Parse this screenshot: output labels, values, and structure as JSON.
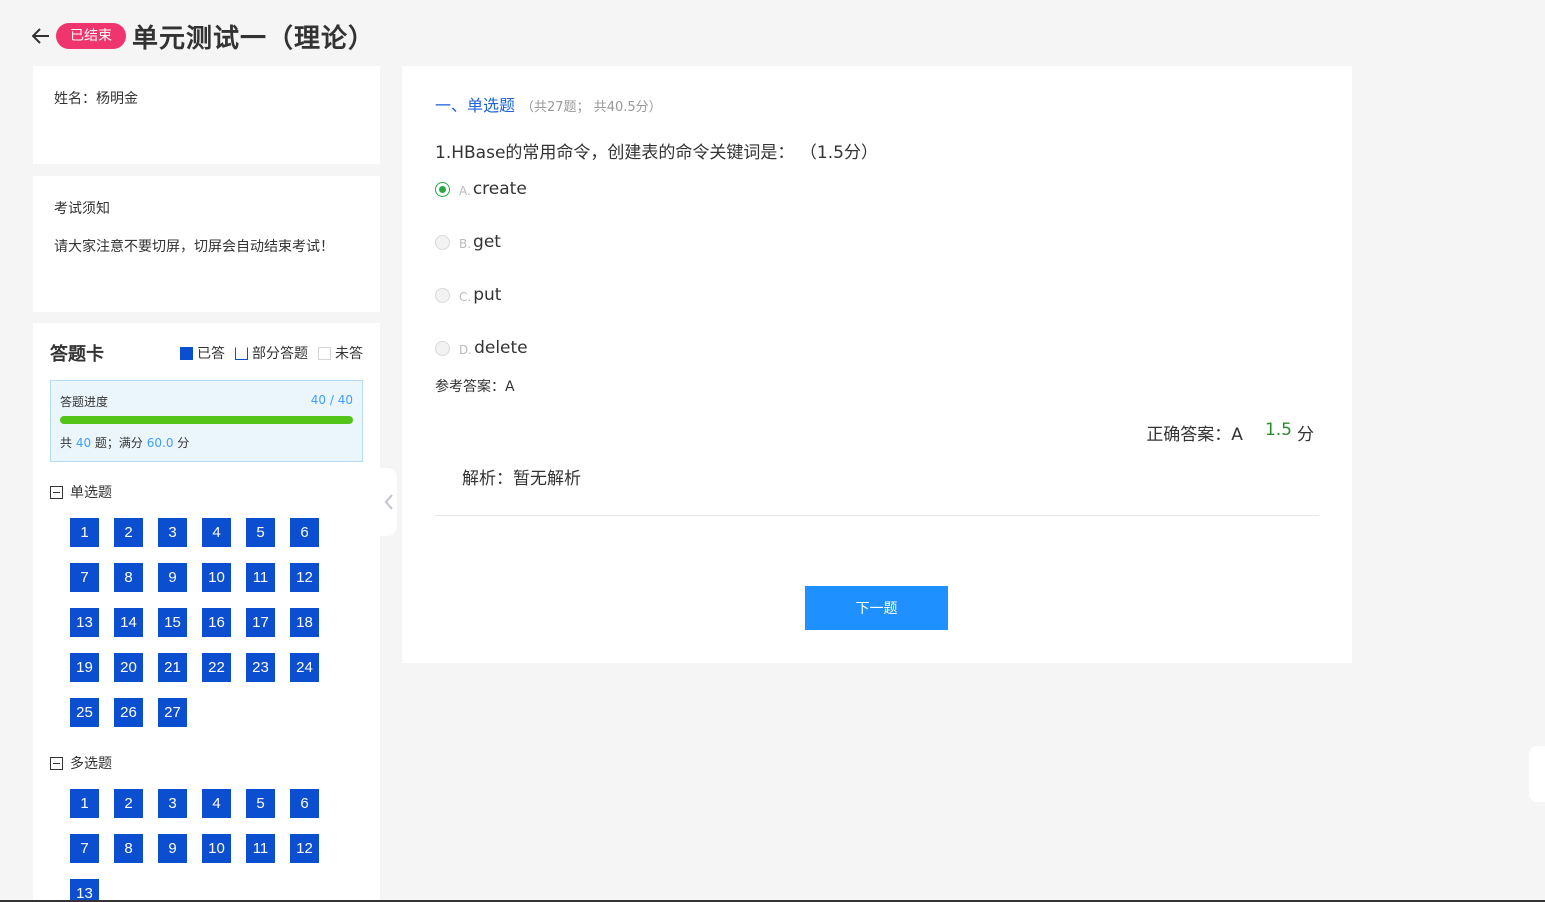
{
  "header": {
    "status_badge": "已结束",
    "title": "单元测试一（理论）"
  },
  "student": {
    "name_text": "姓名：杨明金"
  },
  "notice": {
    "title": "考试须知",
    "body": "请大家注意不要切屏，切屏会自动结束考试！"
  },
  "answer_card": {
    "title": "答题卡",
    "legend": {
      "answered": "已答",
      "partial": "部分答题",
      "unanswered": "未答"
    },
    "progress": {
      "label": "答题进度",
      "done": "40",
      "sep": " / ",
      "total": "40",
      "fraction": 1.0,
      "summary_prefix": "共 ",
      "summary_count": "40",
      "summary_mid": " 题；满分 ",
      "summary_score": "60.0",
      "summary_suffix": " 分"
    },
    "groups": [
      {
        "label": "单选题",
        "items": [
          "1",
          "2",
          "3",
          "4",
          "5",
          "6",
          "7",
          "8",
          "9",
          "10",
          "11",
          "12",
          "13",
          "14",
          "15",
          "16",
          "17",
          "18",
          "19",
          "20",
          "21",
          "22",
          "23",
          "24",
          "25",
          "26",
          "27"
        ]
      },
      {
        "label": "多选题",
        "items": [
          "1",
          "2",
          "3",
          "4",
          "5",
          "6",
          "7",
          "8",
          "9",
          "10",
          "11",
          "12",
          "13"
        ]
      }
    ]
  },
  "question": {
    "section_title": "一、单选题",
    "section_sub": "（共27题； 共40.5分）",
    "text": "1.HBase的常用命令，创建表的命令关键词是：",
    "score": "（1.5分）",
    "options": [
      {
        "letter": "A.",
        "text": "create",
        "checked": true
      },
      {
        "letter": "B.",
        "text": "get",
        "checked": false
      },
      {
        "letter": "C.",
        "text": "put",
        "checked": false
      },
      {
        "letter": "D.",
        "text": "delete",
        "checked": false
      }
    ],
    "reference_answer": "参考答案：A",
    "correct_answer": "正确答案：A",
    "score_value": "1.5",
    "score_unit": "分",
    "analysis": "解析：暂无解析",
    "next_button": "下一题"
  },
  "colors": {
    "accent_blue": "#0b4fd0",
    "status_badge": "#f0346e",
    "progress_green": "#52c41a",
    "next_button": "#1e90ff"
  }
}
